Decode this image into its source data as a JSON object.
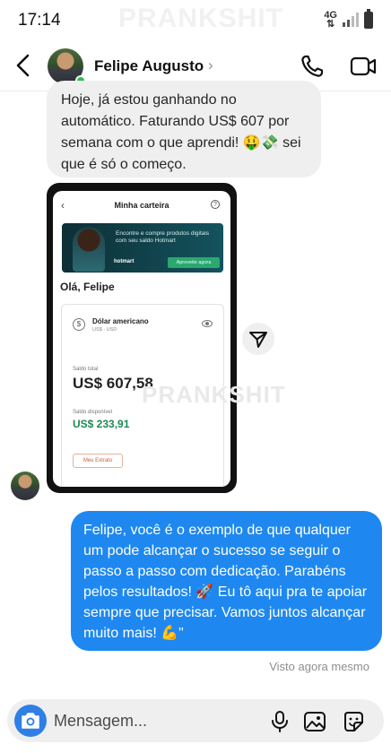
{
  "status_bar": {
    "time": "17:14",
    "watermark": "PRANKSHIT",
    "network": "4G",
    "signal_icon": "signal-icon",
    "battery_icon": "battery-icon"
  },
  "header": {
    "contact_name": "Felipe Augusto",
    "chevron": "›",
    "back_icon": "back-arrow-icon",
    "call_icon": "phone-icon",
    "video_icon": "video-camera-icon",
    "online": true
  },
  "messages": {
    "incoming_text": "Hoje, já estou ganhando no automático. Faturando US$ 607 por semana com o que aprendi! 🤑💸 sei que é só o começo.",
    "screenshot": {
      "back": "‹",
      "title": "Minha carteira",
      "help": "?",
      "banner_text": "Encontre e compre produtos digitais com seu saldo Hotmart",
      "banner_logo": "hotmart",
      "banner_cta": "Aproveite agora",
      "greeting": "Olá, Felipe",
      "coin": "$",
      "currency_name": "Dólar americano",
      "currency_code": "US$ - USD",
      "total_label": "Saldo total",
      "total_value": "US$ 607,58",
      "available_label": "Saldo disponível",
      "available_value": "US$ 233,91",
      "statement_button": "Meu Extrato"
    },
    "watermark": "PRANKSHIT",
    "outgoing_text": "Felipe, você é o exemplo de que qualquer um pode alcançar o sucesso se seguir o passo a passo com dedicação. Parabéns pelos resultados! 🚀 Eu tô aqui pra te apoiar sempre que precisar. Vamos juntos alcançar muito mais! 💪\"",
    "seen_label": "Visto agora mesmo"
  },
  "composer": {
    "placeholder": "Mensagem...",
    "camera_icon": "camera-icon",
    "mic_icon": "microphone-icon",
    "gallery_icon": "gallery-icon",
    "sticker_icon": "sticker-icon"
  },
  "colors": {
    "outgoing_bubble": "#1e88f0",
    "incoming_bubble": "#efefef",
    "online_dot": "#29c14b",
    "camera_button": "#2f7fe6"
  }
}
